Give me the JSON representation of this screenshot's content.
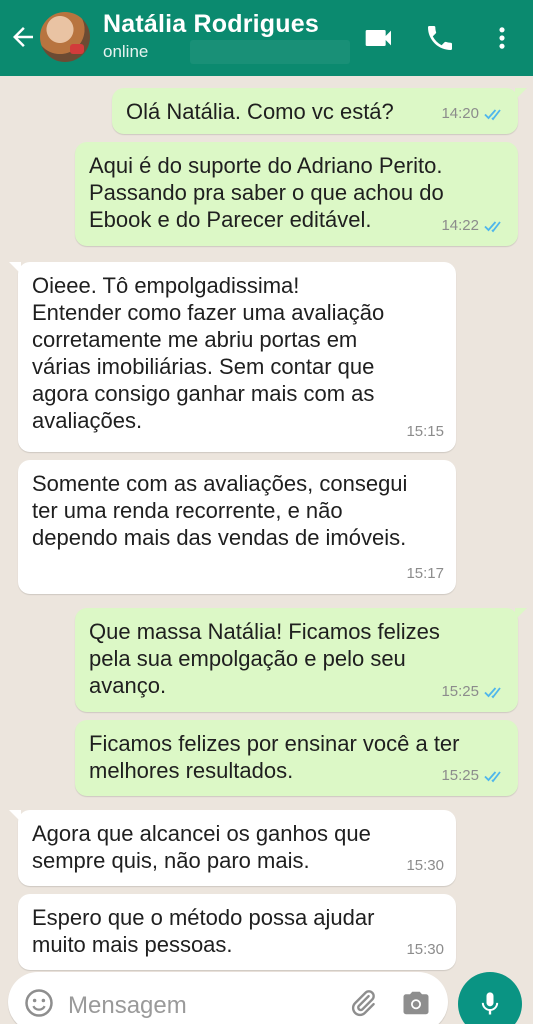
{
  "header": {
    "contact_name": "Natália Rodrigues",
    "status": "online"
  },
  "messages": [
    {
      "direction": "out",
      "text": "Olá Natália.  Como vc está?",
      "time": "14:20",
      "read": true
    },
    {
      "direction": "out",
      "text": "Aqui é do suporte do Adriano Perito.\nPassando pra saber o que achou do\nEbook e do Parecer editável.",
      "time": "14:22",
      "read": true
    },
    {
      "direction": "in",
      "text": "Oieee. Tô empolgadissima!\nEntender como fazer uma avaliação\ncorretamente me abriu portas em\nvárias imobiliárias. Sem contar que\nagora consigo ganhar mais com as\navaliações.",
      "time": "15:15"
    },
    {
      "direction": "in",
      "text": "Somente com as avaliações, consegui\nter uma renda recorrente, e não\ndependo mais das vendas de imóveis.",
      "time": "15:17"
    },
    {
      "direction": "out",
      "text": "Que massa Natália! Ficamos felizes\npela sua empolgação e pelo seu\navanço.",
      "time": "15:25",
      "read": true
    },
    {
      "direction": "out",
      "text": "Ficamos felizes por ensinar você a ter\nmelhores resultados.",
      "time": "15:25",
      "read": true
    },
    {
      "direction": "in",
      "text": "Agora que alcancei os ganhos que\nsempre quis, não paro mais.",
      "time": "15:30"
    },
    {
      "direction": "in",
      "text": "Espero que o método possa ajudar\nmuito mais  pessoas.",
      "time": "15:30"
    }
  ],
  "input": {
    "placeholder": "Mensagem"
  },
  "colors": {
    "header": "#0b8a6f",
    "outgoing_bubble": "#dcf8c6",
    "incoming_bubble": "#ffffff",
    "chat_background": "#ece5dd",
    "read_ticks": "#4fb6ec",
    "mic_button": "#0a9483"
  },
  "icons": [
    "back-arrow-icon",
    "video-call-icon",
    "phone-icon",
    "more-vert-icon",
    "emoji-icon",
    "attach-icon",
    "camera-icon",
    "mic-icon",
    "double-check-icon"
  ]
}
